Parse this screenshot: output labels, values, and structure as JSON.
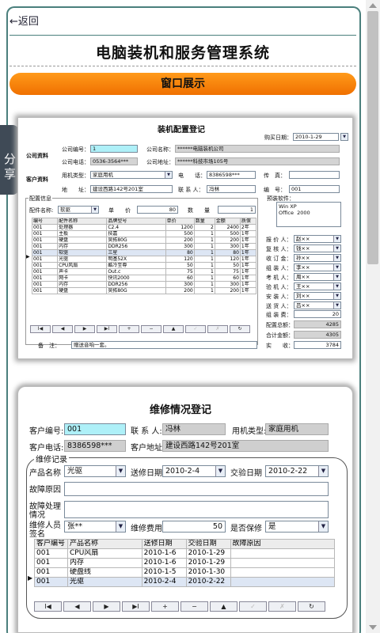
{
  "header": {
    "back_label": "←返回",
    "site_title": "电脑装机和服务管理系统",
    "section_title": "窗口展示"
  },
  "share_tab": {
    "label": "分享"
  },
  "config_window": {
    "title": "装机配置登记",
    "purchase_date_label": "购买日期：",
    "purchase_date": "2010-1-29",
    "company_section_label": "公司资料",
    "company_no_label": "公司编号：",
    "company_no": "1",
    "company_name_label": "公司名称：",
    "company_name": "******电脑装机公司",
    "company_phone_label": "公司电话：",
    "company_phone": "0536-3564***",
    "company_addr_label": "公司地址：",
    "company_addr": "******科技市场105号",
    "customer_section_label": "客户资料",
    "machine_type_label": "用机类型：",
    "machine_type": "家庭用机",
    "phone_label": "电　　话：",
    "phone": "8386598***",
    "fax_label": "传　真：",
    "fax": "",
    "address_label": "地　　址：",
    "address": "建设西路142号201室",
    "contact_label": "联 系 人：",
    "contact": "冯林",
    "code_label": "编　号：",
    "code": "001",
    "config_info_label": "配置信息",
    "part_name_label": "配件名称:",
    "part_name": "软驱",
    "unit_price_label": "单　　价",
    "unit_price": "80",
    "quantity_label": "数　　量",
    "quantity": "1",
    "parts_table": {
      "columns": [
        "编号",
        "配件名称",
        "品牌型号",
        "单价",
        "数量",
        "金额",
        "质保"
      ],
      "rows": [
        [
          "001",
          "处理器",
          "C2.4",
          "1200",
          "2",
          "2400",
          "2年"
        ],
        [
          "001",
          "主板",
          "技嘉",
          "500",
          "1",
          "500",
          "1年"
        ],
        [
          "001",
          "硬盘",
          "昊拓80G",
          "200",
          "1",
          "200",
          "1年"
        ],
        [
          "001",
          "内存",
          "DDR256",
          "300",
          "1",
          "300",
          "1年"
        ],
        [
          "001",
          "软驱",
          "三星",
          "80",
          "1",
          "80",
          "1年"
        ],
        [
          "001",
          "光驱",
          "明基52X",
          "120",
          "1",
          "120",
          "1年"
        ],
        [
          "001",
          "CPU风扇",
          "酷冷至尊",
          "50",
          "1",
          "50",
          "1年"
        ],
        [
          "001",
          "声卡",
          "Out.c",
          "75",
          "1",
          "75",
          "1年"
        ],
        [
          "001",
          "网卡",
          "快讯2000",
          "60",
          "1",
          "60",
          "1年"
        ],
        [
          "001",
          "内存",
          "DDR256",
          "300",
          "1",
          "300",
          "1年"
        ],
        [
          "001",
          "硬盘",
          "昊拓80G",
          "200",
          "1",
          "200",
          "1年"
        ]
      ]
    },
    "nav_buttons": [
      "I◀",
      "◀",
      "▶",
      "▶I",
      "+",
      "−",
      "▲",
      "✓",
      "✗",
      "↻"
    ],
    "remark_label": "备　注：",
    "remark": "赠送音响一套。",
    "preinstalled_label": "预装软件：",
    "preinstalled": "Win XP\nOffice  2000",
    "staff": [
      {
        "label": "报 价 人：",
        "value": "赵××"
      },
      {
        "label": "复 核 人：",
        "value": "钱××"
      },
      {
        "label": "收 订 金：",
        "value": "孙××"
      },
      {
        "label": "组 装 人：",
        "value": "李××"
      },
      {
        "label": "考 机 人：",
        "value": "周××"
      },
      {
        "label": "验 机 人：",
        "value": "王××"
      },
      {
        "label": "安 装 人：",
        "value": "刘××"
      },
      {
        "label": "送 货 人：",
        "value": "吕××"
      }
    ],
    "assembly_fee_label": "组 装 费：",
    "assembly_fee": "20",
    "config_total_label": "配置总额：",
    "config_total": "4285",
    "grand_total_label": "合计金额：",
    "grand_total": "4305",
    "paid_label": "实　　收：",
    "paid": "3784"
  },
  "repair_window": {
    "title": "维修情况登记",
    "customer_no_label": "客户编号:",
    "customer_no": "001",
    "contact_label": "联 系 人:",
    "contact": "冯林",
    "machine_type_label": "用机类型:",
    "machine_type": "家庭用机",
    "customer_phone_label": "客户电话:",
    "customer_phone": "8386598***",
    "customer_addr_label": "客户地址:",
    "customer_addr": "建设西路142号201室",
    "records_label": "维修记录",
    "product_name_label": "产品名称",
    "product_name": "光驱",
    "send_date_label": "送修日期",
    "send_date": "2010-2-4",
    "deliver_date_label": "交验日期",
    "deliver_date": "2010-2-22",
    "fault_reason_label": "故障原因",
    "fault_reason": "",
    "fault_handling_label": "故障处理情况",
    "fault_handling": "",
    "repairer_label": "维修人员签名",
    "repairer": "张**",
    "repair_fee_label": "维修费用",
    "repair_fee": "50",
    "warranty_label": "是否保修",
    "warranty": "是",
    "records_table": {
      "columns": [
        "客户编号",
        "产品名称",
        "送修日期",
        "交验日期",
        "故障原因"
      ],
      "rows": [
        [
          "001",
          "CPU风扇",
          "2010-1-6",
          "2010-1-29",
          ""
        ],
        [
          "001",
          "内存",
          "2010-1-6",
          "2010-1-29",
          ""
        ],
        [
          "001",
          "硬盘线",
          "2010-1-5",
          "2010-1-30",
          ""
        ],
        [
          "001",
          "光驱",
          "2010-2-4",
          "2010-2-22",
          ""
        ]
      ]
    },
    "nav_buttons": [
      "I◀",
      "◀",
      "▶",
      "▶I",
      "+",
      "−",
      "▲",
      "✓",
      "✗",
      "↻"
    ]
  }
}
